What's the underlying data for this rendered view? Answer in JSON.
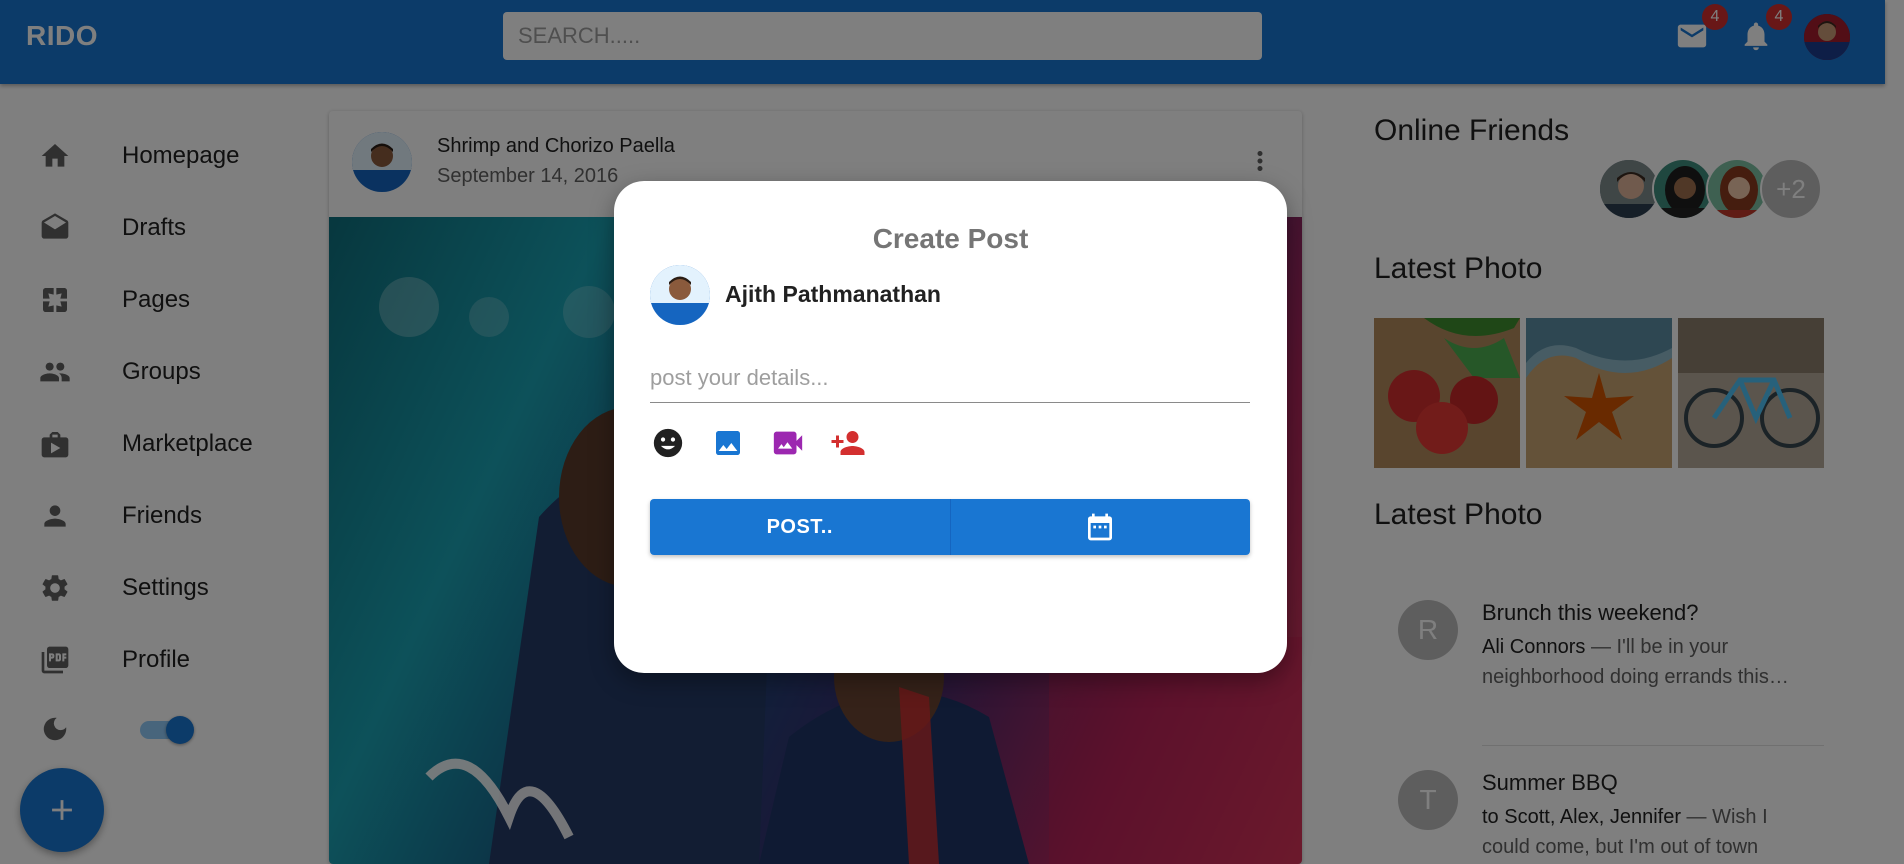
{
  "app": {
    "brand": "RIDO",
    "search_placeholder": "SEARCH.....",
    "mail_badge": "4",
    "notifications_badge": "4"
  },
  "sidebar": {
    "items": [
      {
        "label": "Homepage",
        "icon": "home-icon"
      },
      {
        "label": "Drafts",
        "icon": "drafts-icon"
      },
      {
        "label": "Pages",
        "icon": "pages-icon"
      },
      {
        "label": "Groups",
        "icon": "groups-icon"
      },
      {
        "label": "Marketplace",
        "icon": "storefront-icon"
      },
      {
        "label": "Friends",
        "icon": "person-icon"
      },
      {
        "label": "Settings",
        "icon": "gear-icon"
      },
      {
        "label": "Profile",
        "icon": "pdf-icon"
      }
    ],
    "dark_mode_on": true
  },
  "post": {
    "title": "Shrimp and Chorizo Paella",
    "date": "September 14, 2016"
  },
  "right_panel": {
    "online_friends_title": "Online Friends",
    "online_friends_more": "+2",
    "latest_photo_title": "Latest Photo",
    "latest_photo_title_2": "Latest Photo",
    "messages": [
      {
        "initial": "R",
        "title": "Brunch this weekend?",
        "sender": "Ali Connors",
        "snippet": " — I'll be in your neighborhood doing errands this…"
      },
      {
        "initial": "T",
        "title": "Summer BBQ",
        "sender": "to Scott, Alex, Jennifer",
        "snippet": " — Wish I could come, but I'm out of town"
      }
    ]
  },
  "modal": {
    "title": "Create Post",
    "user_name": "Ajith Pathmanathan",
    "input_placeholder": "post your details...",
    "input_value": "",
    "post_button": "POST..",
    "colors": {
      "emoji": "#212121",
      "image": "#1976d2",
      "video": "#9c27b0",
      "tag": "#d32f2f"
    }
  },
  "colors": {
    "primary": "#1976d2",
    "badge": "#d32f2f"
  }
}
